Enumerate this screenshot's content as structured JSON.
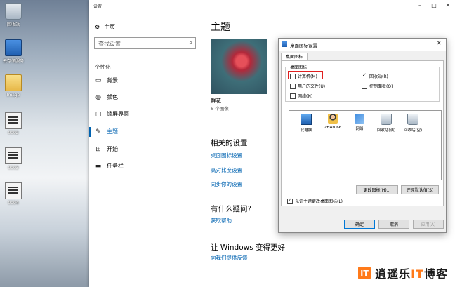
{
  "desktop": {
    "icons": [
      {
        "label": "回收站",
        "icon": "recycle-bin-icon"
      },
      {
        "label": "云存储服务",
        "icon": "computer-icon"
      },
      {
        "label": "Image",
        "icon": "folder-icon"
      },
      {
        "label": "0002",
        "icon": "file-icon"
      },
      {
        "label": "0003",
        "icon": "file-icon"
      },
      {
        "label": "0004",
        "icon": "file-icon"
      }
    ]
  },
  "settings": {
    "window_title": "设置",
    "home": "主页",
    "search_placeholder": "查找设置",
    "section": "个性化",
    "nav": [
      {
        "label": "背景",
        "icon": "image-icon"
      },
      {
        "label": "颜色",
        "icon": "palette-icon"
      },
      {
        "label": "锁屏界面",
        "icon": "lock-screen-icon"
      },
      {
        "label": "主题",
        "icon": "brush-icon"
      },
      {
        "label": "开始",
        "icon": "start-icon"
      },
      {
        "label": "任务栏",
        "icon": "taskbar-icon"
      }
    ],
    "page_title": "主题",
    "theme": {
      "name": "鲜花",
      "count": "6 个图像"
    },
    "related_title": "相关的设置",
    "related_links": [
      "桌面图标设置",
      "高对比度设置",
      "同步你的设置"
    ],
    "question_title": "有什么疑问?",
    "help_link": "获取帮助",
    "improve_title": "让 Windows 变得更好",
    "feedback_link": "向我们提供反馈"
  },
  "dialog": {
    "title": "桌面图标设置",
    "tab": "桌面图标",
    "group_label": "桌面图标",
    "checkboxes": [
      {
        "label": "计算机(M)",
        "checked": false
      },
      {
        "label": "回收站(R)",
        "checked": true
      },
      {
        "label": "用户的文件(U)",
        "checked": false
      },
      {
        "label": "控制面板(O)",
        "checked": false
      },
      {
        "label": "网络(N)",
        "checked": false
      }
    ],
    "icons": [
      "此电脑",
      "ZHAN 66",
      "网络",
      "回收站(满)",
      "回收站(空)"
    ],
    "change_icon": "更改图标(H)...",
    "restore_default": "还原默认值(S)",
    "allow_themes": "允许主题更改桌面图标(L)",
    "ok": "确定",
    "cancel": "取消",
    "apply": "应用(A)"
  },
  "watermark": {
    "logo_letter": "IT",
    "text_before": "逍遥乐",
    "text_it": "IT",
    "text_after": "博客"
  },
  "colors": {
    "accent": "#0063b1",
    "highlight": "#e02020",
    "brand": "#ff7a1a"
  }
}
